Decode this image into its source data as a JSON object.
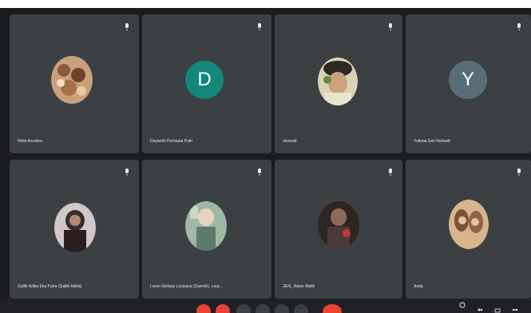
{
  "participants": [
    {
      "name": "Nelia Azzahra",
      "avatar": "photo"
    },
    {
      "name": "Dayanthi Permana Putri",
      "avatar": "letter",
      "letter": "D",
      "color": "#12877a"
    },
    {
      "name": "Juneedi",
      "avatar": "photo"
    },
    {
      "name": "Yuliana Sari Nurbadi",
      "avatar": "letter",
      "letter": "Y",
      "color": "#5a6e78"
    },
    {
      "name": "Gallik Aditia Eka Putra (Gallik Aditia)",
      "avatar": "photo"
    },
    {
      "name": "Loren Stefany Louisana (Gumrih), Loui...",
      "avatar": "photo"
    },
    {
      "name": "ZEN_ Adam Malik",
      "avatar": "photo"
    },
    {
      "name": "Anda",
      "avatar": "photo"
    }
  ],
  "colors": {
    "tile_bg": "#3c4043",
    "page_bg": "#1c1d20",
    "end_call": "#ea4335"
  },
  "icons": {
    "tile_mic": "mic-off-icon",
    "controls": [
      "mic-off-icon",
      "camera-off-icon",
      "captions-icon",
      "hand-icon",
      "present-icon",
      "more-icon",
      "end-call-icon"
    ],
    "right": [
      "info-icon",
      "people-icon",
      "chat-icon",
      "activities-icon"
    ]
  }
}
